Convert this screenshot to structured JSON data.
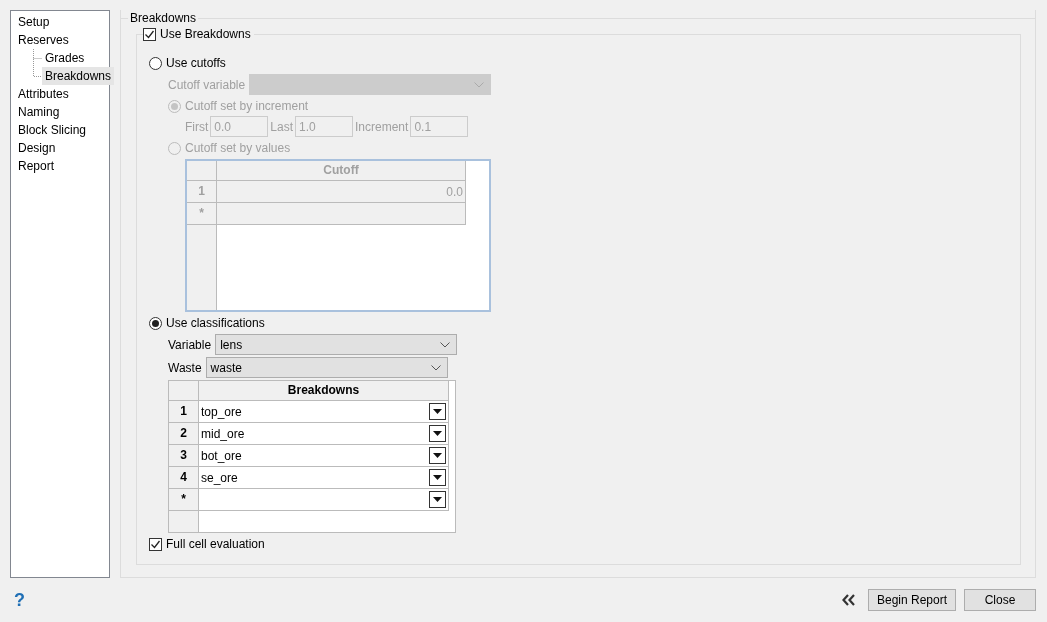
{
  "sidebar": {
    "items": [
      {
        "label": "Setup",
        "selected": false
      },
      {
        "label": "Reserves",
        "selected": false,
        "children": [
          {
            "label": "Grades",
            "selected": false
          },
          {
            "label": "Breakdowns",
            "selected": true
          }
        ]
      },
      {
        "label": "Attributes",
        "selected": false
      },
      {
        "label": "Naming",
        "selected": false
      },
      {
        "label": "Block Slicing",
        "selected": false
      },
      {
        "label": "Design",
        "selected": false
      },
      {
        "label": "Report",
        "selected": false
      }
    ]
  },
  "group": {
    "title": "Breakdowns"
  },
  "use_breakdowns": {
    "label": "Use Breakdowns",
    "checked": true
  },
  "cutoffs": {
    "label": "Use cutoffs",
    "selected": false,
    "disabled": true,
    "cutoff_variable": {
      "label": "Cutoff variable"
    },
    "by_increment": {
      "label": "Cutoff set by increment",
      "selected": true
    },
    "fields": [
      {
        "label": "First",
        "value": "0.0"
      },
      {
        "label": "Last",
        "value": "1.0"
      },
      {
        "label": "Increment",
        "value": "0.1"
      }
    ],
    "by_values": {
      "label": "Cutoff set by values",
      "selected": false
    },
    "table": {
      "columns": [
        "Cutoff"
      ],
      "rows": [
        {
          "header": "1",
          "value": "0.0"
        },
        {
          "header": "*"
        }
      ]
    }
  },
  "classifications": {
    "label": "Use classifications",
    "selected": true,
    "variable": {
      "label": "Variable",
      "value": "lens"
    },
    "waste": {
      "label": "Waste",
      "value": "waste"
    },
    "table": {
      "columns": [
        "Breakdowns"
      ],
      "rows": [
        {
          "header": "1",
          "value": "top_ore"
        },
        {
          "header": "2",
          "value": "mid_ore"
        },
        {
          "header": "3",
          "value": "bot_ore"
        },
        {
          "header": "4",
          "value": "se_ore"
        },
        {
          "header": "*"
        }
      ]
    }
  },
  "full_cell": {
    "label": "Full cell evaluation",
    "checked": true
  },
  "help": "?",
  "buttons": [
    "Begin Report",
    "Close"
  ]
}
